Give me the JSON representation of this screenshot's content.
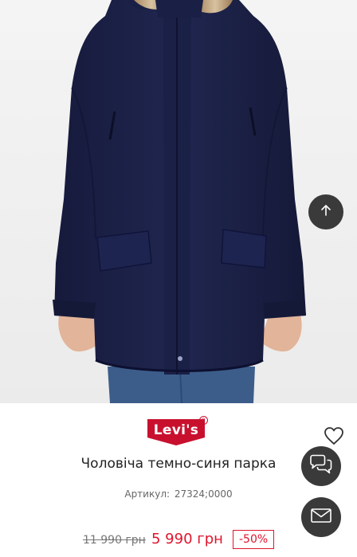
{
  "product": {
    "brand": "Levi's",
    "title": "Чоловіча темно-синя парка",
    "sku_label": "Артикул:",
    "sku_value": "27324;0000"
  },
  "pricing": {
    "old_price": "11 990 грн",
    "new_price": "5 990 грн",
    "discount": "-50%"
  },
  "colors": {
    "jacket": "#1c2148",
    "accent_red": "#e0142d",
    "button_dark": "#3a3a3a",
    "brand_red": "#c8102e"
  },
  "icons": {
    "scroll_top": "arrow-up-icon",
    "wishlist": "heart-outline-icon",
    "chat": "chat-bubbles-icon",
    "mail": "envelope-icon"
  }
}
